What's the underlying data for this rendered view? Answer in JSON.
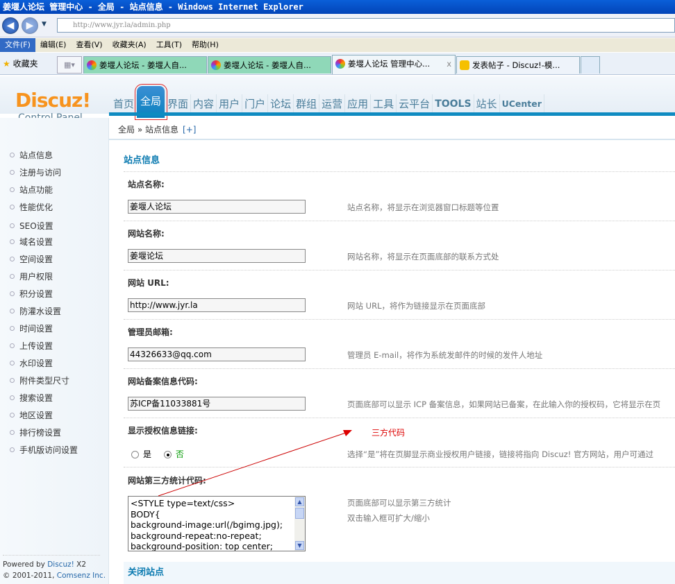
{
  "window": {
    "title": "姜堰人论坛 管理中心 - 全局 - 站点信息 - Windows Internet Explorer",
    "url": "http://www.jyr.la/admin.php"
  },
  "menu": [
    "文件(F)",
    "编辑(E)",
    "查看(V)",
    "收藏夹(A)",
    "工具(T)",
    "帮助(H)"
  ],
  "favorites": "收藏夹",
  "tabs": [
    "姜堰人论坛 - 姜堰人自...",
    "姜堰人论坛 - 姜堰人自...",
    "姜堰人论坛 管理中心...",
    "发表帖子 - Discuz!-模..."
  ],
  "logo": {
    "brand": "Discuz!",
    "sub": "Control Panel"
  },
  "nav": [
    "首页",
    "全局",
    "界面",
    "内容",
    "用户",
    "门户",
    "论坛",
    "群组",
    "运营",
    "应用",
    "工具",
    "云平台",
    "TOOLS",
    "站长",
    "UCenter"
  ],
  "breadcrumb": {
    "a": "全局",
    "sep": "»",
    "b": "站点信息",
    "plus": "[+]"
  },
  "sidebar": [
    "站点信息",
    "注册与访问",
    "站点功能",
    "性能优化",
    "SEO设置",
    "域名设置",
    "空间设置",
    "用户权限",
    "积分设置",
    "防灌水设置",
    "时间设置",
    "上传设置",
    "水印设置",
    "附件类型尺寸",
    "搜索设置",
    "地区设置",
    "排行榜设置",
    "手机版访问设置"
  ],
  "footer": {
    "powered": "Powered by",
    "brand": "Discuz!",
    "ver": "X2",
    "copy": "© 2001-2011,",
    "company": "Comsenz Inc."
  },
  "section_title": "站点信息",
  "fields": [
    {
      "label": "站点名称:",
      "value": "姜堰人论坛",
      "help": "站点名称，将显示在浏览器窗口标题等位置"
    },
    {
      "label": "网站名称:",
      "value": "姜堰论坛",
      "help": "网站名称，将显示在页面底部的联系方式处"
    },
    {
      "label": "网站 URL:",
      "value": "http://www.jyr.la",
      "help": "网站 URL，将作为链接显示在页面底部"
    },
    {
      "label": "管理员邮箱:",
      "value": "44326633@qq.com",
      "help": "管理员 E-mail，将作为系统发邮件的时候的发件人地址"
    },
    {
      "label": "网站备案信息代码:",
      "value": "苏ICP备11033881号",
      "help": "页面底部可以显示 ICP 备案信息，如果网站已备案，在此输入你的授权码，它将显示在页"
    }
  ],
  "license": {
    "label": "显示授权信息链接:",
    "yes": "是",
    "no": "否",
    "help": "选择“是”将在页脚显示商业授权用户链接，链接将指向 Discuz! 官方网站，用户可通过"
  },
  "stats": {
    "label": "网站第三方统计代码:",
    "code": "<STYLE type=text/css>\nBODY{\nbackground-image:url(/bgimg.jpg);\nbackground-repeat:no-repeat;\nbackground-position: top center;\nbackground-color:#fff;",
    "help1": "页面底部可以显示第三方统计",
    "help2": "双击输入框可扩大/缩小"
  },
  "annotation": "三方代码",
  "close_section": "关闭站点"
}
